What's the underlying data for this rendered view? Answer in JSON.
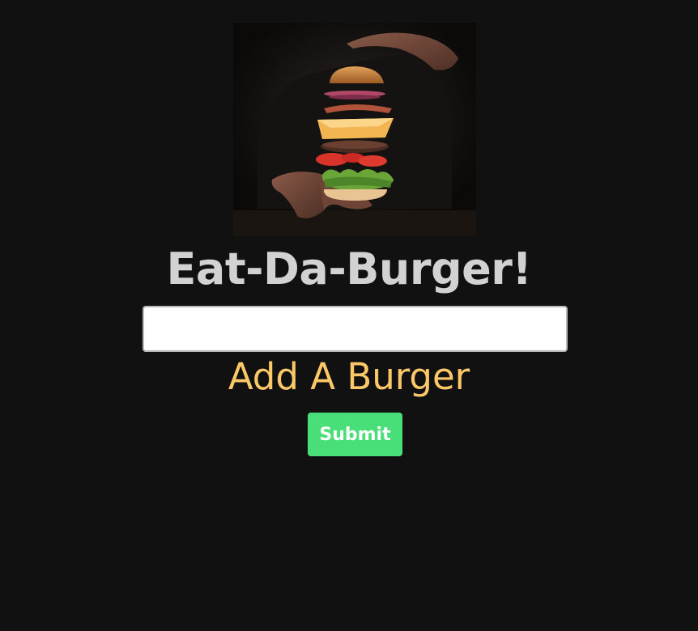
{
  "header": {
    "image_alt": "Floating burger",
    "title": "Eat-Da-Burger!"
  },
  "form": {
    "input_value": "",
    "input_placeholder": "",
    "label": "Add A Burger",
    "submit_label": "Submit"
  },
  "colors": {
    "background": "#111111",
    "title": "#d2d2d2",
    "label_accent": "#fdc867",
    "submit_button": "#48df79"
  }
}
